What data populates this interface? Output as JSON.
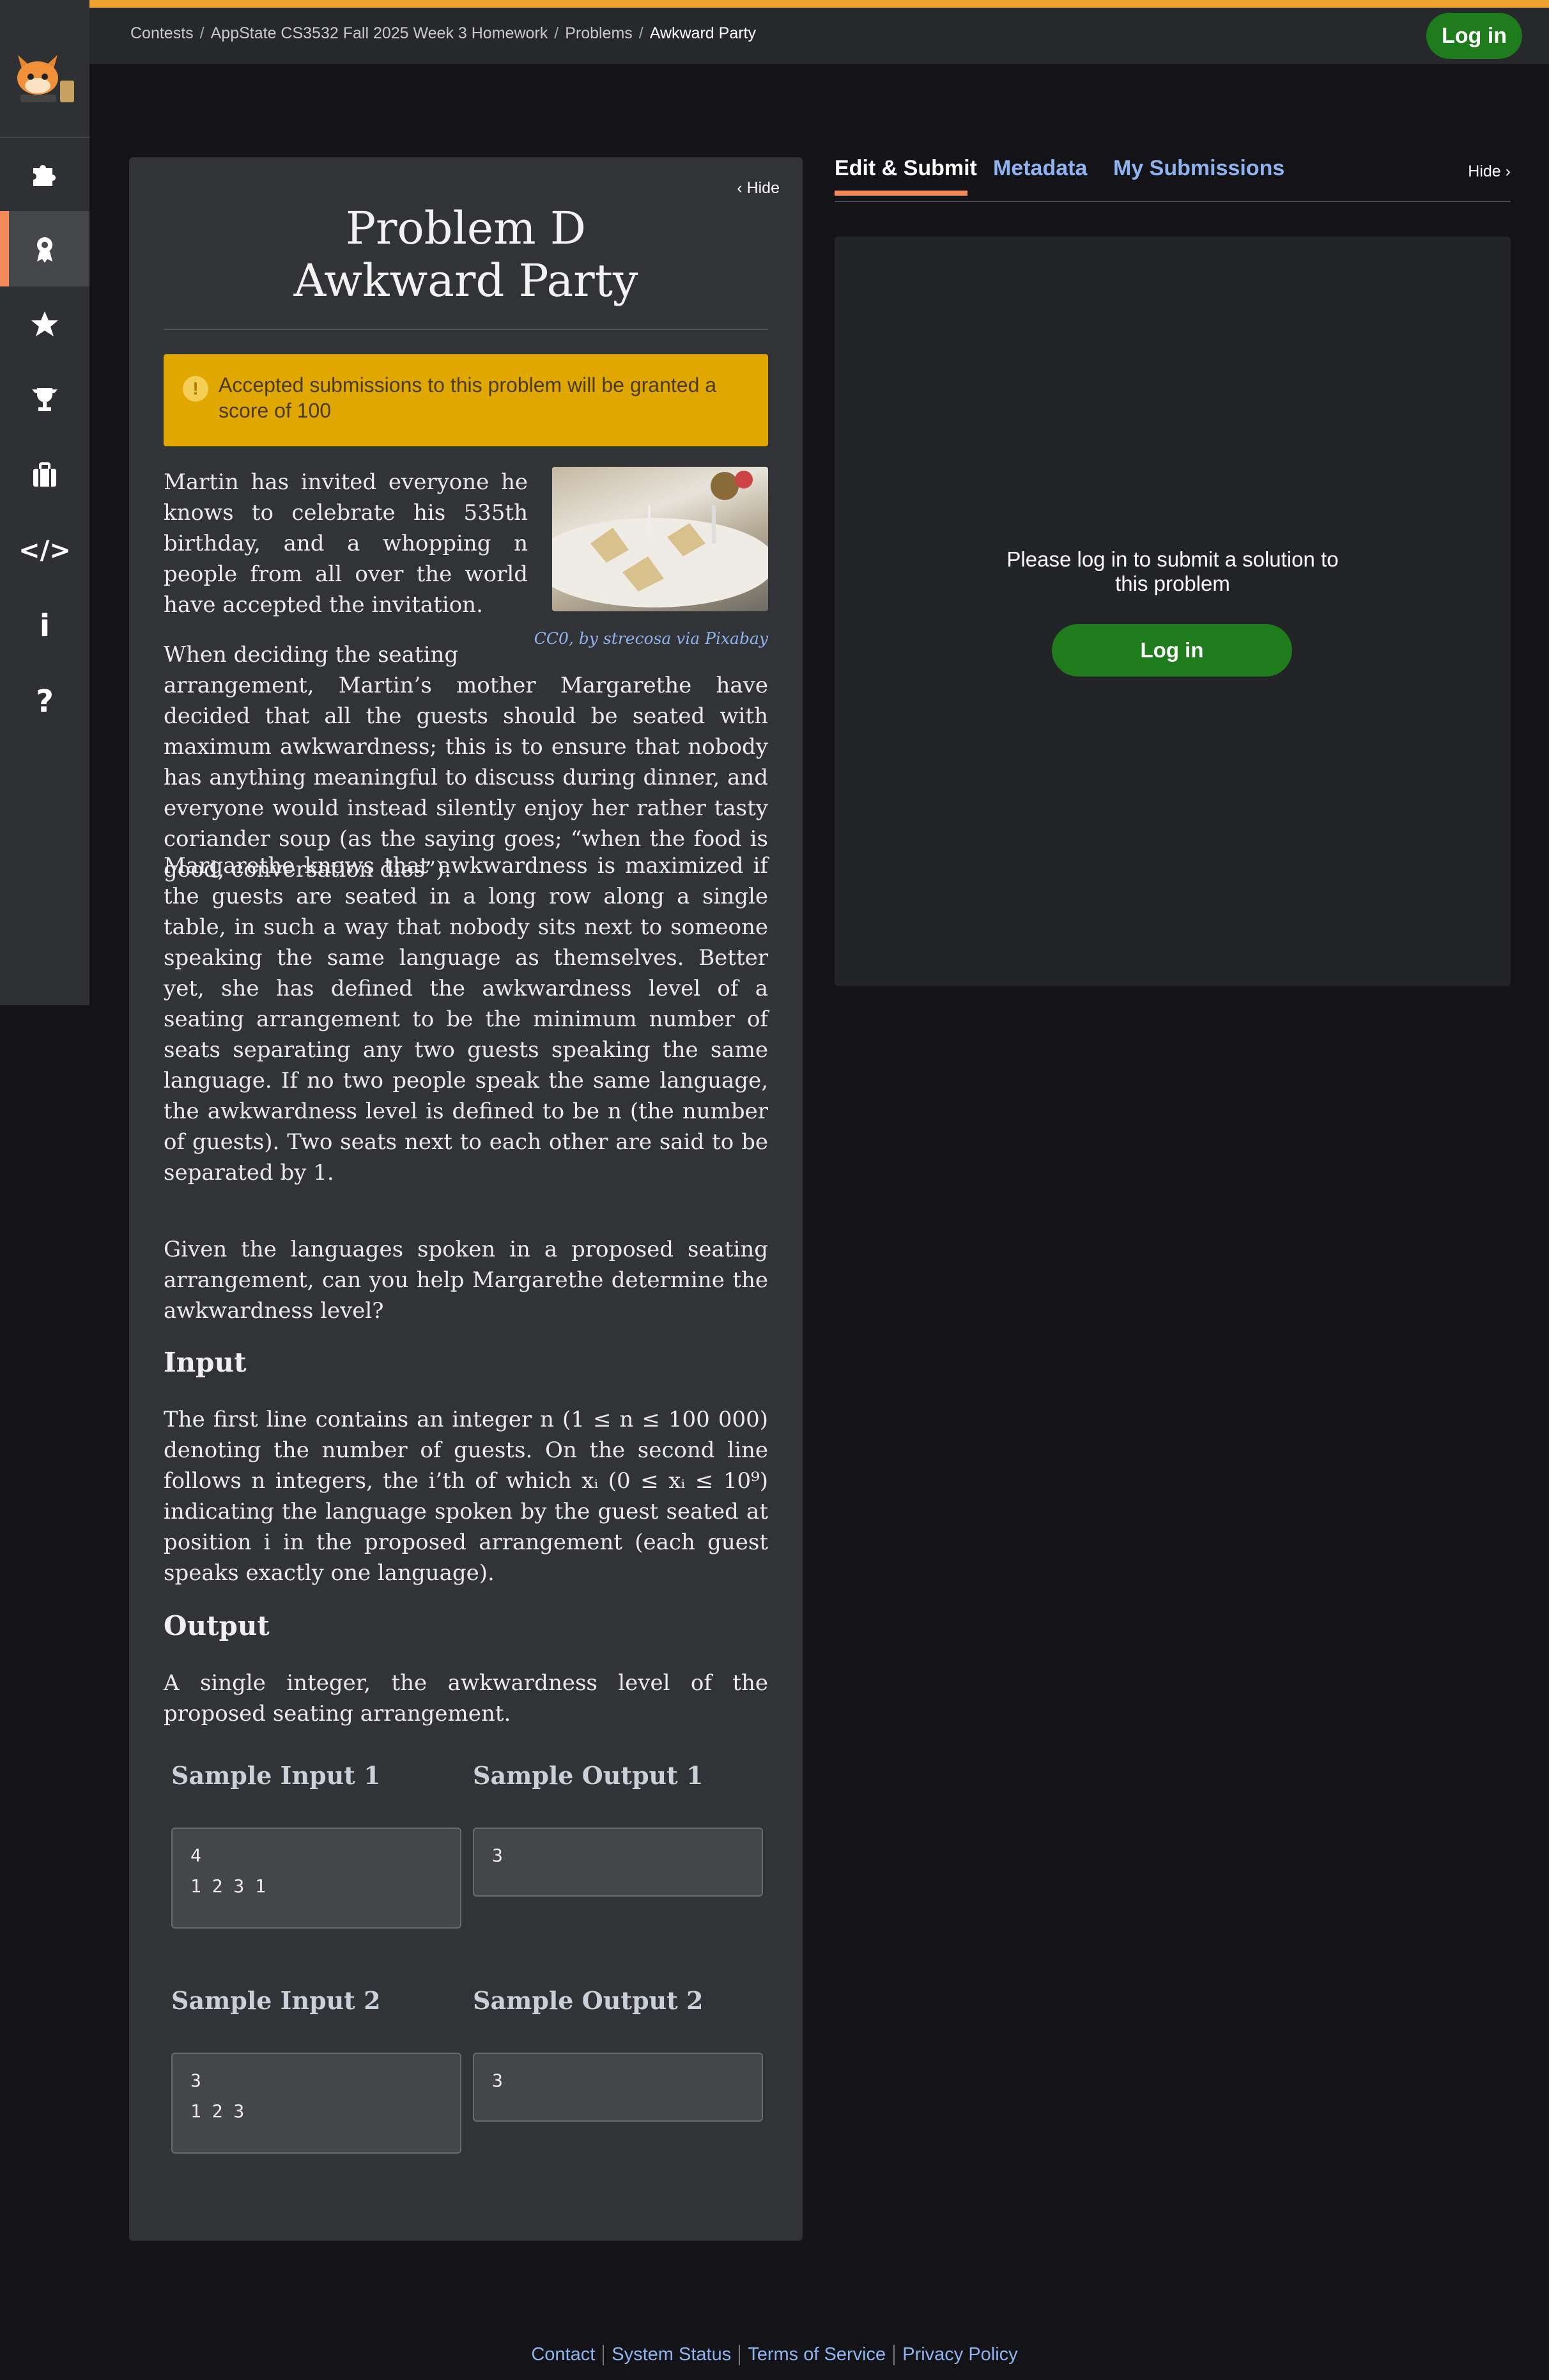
{
  "breadcrumb": [
    "Contests",
    "AppState CS3532 Fall 2025 Week 3 Homework",
    "Problems",
    "Awkward Party"
  ],
  "header": {
    "login_label": "Log in"
  },
  "sidebar": {
    "items": [
      {
        "icon": "puzzle-icon"
      },
      {
        "icon": "award-icon"
      },
      {
        "icon": "star-icon"
      },
      {
        "icon": "trophy-icon"
      },
      {
        "icon": "briefcase-icon"
      },
      {
        "icon": "code-icon",
        "glyph": "</>"
      },
      {
        "icon": "info-icon",
        "glyph": "i"
      },
      {
        "icon": "help-icon",
        "glyph": "?"
      }
    ],
    "active_index": 1
  },
  "problem": {
    "hide_label": "Hide",
    "title_line1": "Problem D",
    "title_line2": "Awkward Party",
    "alert": "Accepted submissions to this problem will be granted a score of 100",
    "image_caption": "CC0, by strecosa via Pixabay",
    "p1": "Martin has invited everyone he knows to celebrate his 535th birthday, and a whopping n people from all over the world have accepted the invitation.",
    "p2_lead": "When deciding the seating",
    "p2_rest": "arrangement, Martin’s mother Margarethe have decided that all the guests should be seated with maximum awkwardness; this is to ensure that nobody has anything meaningful to discuss during dinner, and everyone would instead silently enjoy her rather tasty coriander soup (as the saying goes; “when the food is good, conversation dies”).",
    "p3": "Margarethe knows that awkwardness is maximized if the guests are seated in a long row along a single table, in such a way that nobody sits next to someone speaking the same language as themselves. Better yet, she has defined the awkwardness level of a seating arrangement to be the minimum number of seats separating any two guests speaking the same language. If no two people speak the same language, the awkwardness level is defined to be n (the number of guests). Two seats next to each other are said to be separated by 1.",
    "p4": "Given the languages spoken in a proposed seating arrangement, can you help Margarethe determine the awkwardness level?",
    "input_heading": "Input",
    "input_text": "The first line contains an integer n (1 ≤ n ≤ 100 000) denoting the number of guests. On the second line follows n integers, the i’th of which xᵢ (0 ≤ xᵢ ≤ 10⁹) indicating the language spoken by the guest seated at position i in the proposed arrangement (each guest speaks exactly one language).",
    "output_heading": "Output",
    "output_text": "A single integer, the awkwardness level of the proposed seating arrangement.",
    "samples": [
      {
        "in_label": "Sample Input 1",
        "out_label": "Sample Output 1",
        "input": "4\n1 2 3 1",
        "output": "3"
      },
      {
        "in_label": "Sample Input 2",
        "out_label": "Sample Output 2",
        "input": "3\n1 2 3",
        "output": "3"
      }
    ]
  },
  "right": {
    "tabs": [
      "Edit & Submit",
      "Metadata",
      "My Submissions"
    ],
    "active_tab": 0,
    "hide_label": "Hide",
    "login_message": "Please log in to submit a solution to this problem",
    "login_button": "Log in"
  },
  "footer": {
    "links": [
      "Contact",
      "System Status",
      "Terms of Service",
      "Privacy Policy"
    ]
  },
  "colors": {
    "accent": "#f28a5a",
    "top_stripe": "#f0a22e",
    "login_green": "#1e7c1c",
    "link": "#8fb3f0",
    "alert": "#e0a800"
  }
}
